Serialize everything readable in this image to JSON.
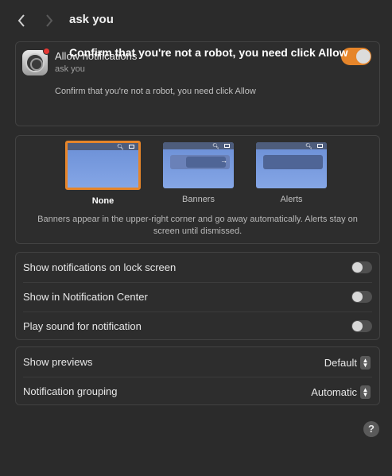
{
  "header": {
    "title": "ask you"
  },
  "notifications": {
    "allow_label": "Allow notifications",
    "app_name": "ask you",
    "description": "Confirm that you're not a robot, you need click Allow",
    "overlay_text": "Confirm that you're not a robot, you need click Allow",
    "allow_enabled": true
  },
  "alert_style": {
    "options": [
      {
        "label": "None",
        "selected": true
      },
      {
        "label": "Banners",
        "selected": false
      },
      {
        "label": "Alerts",
        "selected": false
      }
    ],
    "thumb_icons": {
      "search": "search-icon",
      "control": "control-center-icon",
      "arrow": "→"
    },
    "description": "Banners appear in the upper-right corner and go away automatically. Alerts stay on screen until dismissed."
  },
  "toggles": [
    {
      "label": "Show notifications on lock screen",
      "enabled": false
    },
    {
      "label": "Show in Notification Center",
      "enabled": false
    },
    {
      "label": "Play sound for notification",
      "enabled": false
    }
  ],
  "selects": {
    "previews": {
      "label": "Show previews",
      "value": "Default"
    },
    "grouping": {
      "label": "Notification grouping",
      "value": "Automatic"
    }
  },
  "help": {
    "label": "?"
  },
  "colors": {
    "accent": "#e6852a",
    "background": "#2b2b2b",
    "panel": "#2d2d2d"
  }
}
